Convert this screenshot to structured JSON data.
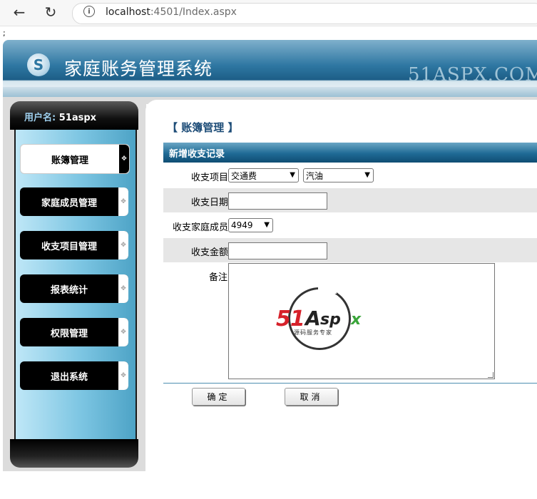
{
  "browser": {
    "url_host": "localhost",
    "url_path": ":4501/Index.aspx",
    "back_glyph": "←",
    "reload_glyph": "↻",
    "info_glyph": "i"
  },
  "stray_text": ";",
  "header": {
    "logo_glyph": "S",
    "title": "家庭账务管理系统",
    "watermark": "51ASPX.COM"
  },
  "sidebar": {
    "user_label": "用户名:",
    "user_name": "51aspx",
    "items": [
      {
        "label": "账簿管理",
        "active": true
      },
      {
        "label": "家庭成员管理",
        "active": false
      },
      {
        "label": "收支项目管理",
        "active": false
      },
      {
        "label": "报表统计",
        "active": false
      },
      {
        "label": "权限管理",
        "active": false
      },
      {
        "label": "退出系统",
        "active": false
      }
    ],
    "tab_glyph": "✥"
  },
  "main": {
    "section_title": "【 账簿管理 】",
    "form_title": "新增收支记录",
    "fields": {
      "item_label": "收支项目",
      "item_category": "交通费",
      "item_sub": "汽油",
      "date_label": "收支日期",
      "date_value": "",
      "member_label": "收支家庭成员",
      "member_value": "4949",
      "amount_label": "收支金额",
      "amount_value": "",
      "note_label": "备注"
    },
    "ok_button": "确定",
    "cancel_button": "取消"
  },
  "textarea_logo": {
    "num": "51",
    "a": "A",
    "sp": "sp",
    "x": "x",
    "sub": "源码服务专家"
  },
  "colors": {
    "header_blue": "#2e77a2",
    "form_head": "#1f6a95",
    "logo_red": "#d6212a",
    "logo_green": "#3aa53a"
  }
}
